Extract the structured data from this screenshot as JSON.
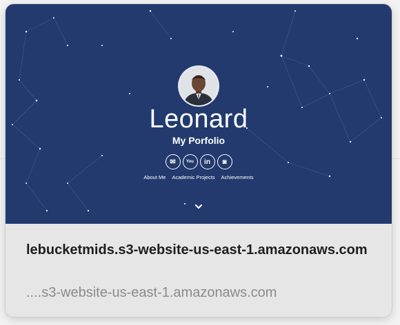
{
  "hero": {
    "name": "Leonard",
    "subtitle": "My Porfolio",
    "social_icons": [
      "email-icon",
      "youtube-icon",
      "linkedin-icon",
      "github-icon"
    ],
    "social_glyphs": [
      "✉",
      "You",
      "in",
      "◙"
    ],
    "nav": [
      "About Me",
      "Academic Projects",
      "Achievements"
    ],
    "background_color": "#223a6e"
  },
  "preview": {
    "title": "lebucketmids.s3-website-us-east-1.amazonaws.com",
    "url": "....s3-website-us-east-1.amazonaws.com"
  }
}
